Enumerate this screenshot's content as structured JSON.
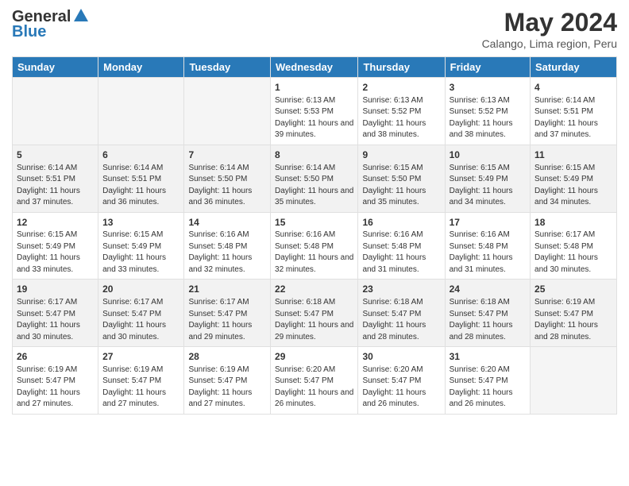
{
  "logo": {
    "line1": "General",
    "line2": "Blue"
  },
  "title": "May 2024",
  "subtitle": "Calango, Lima region, Peru",
  "weekdays": [
    "Sunday",
    "Monday",
    "Tuesday",
    "Wednesday",
    "Thursday",
    "Friday",
    "Saturday"
  ],
  "weeks": [
    [
      {
        "day": "",
        "sunrise": "",
        "sunset": "",
        "daylight": ""
      },
      {
        "day": "",
        "sunrise": "",
        "sunset": "",
        "daylight": ""
      },
      {
        "day": "",
        "sunrise": "",
        "sunset": "",
        "daylight": ""
      },
      {
        "day": "1",
        "sunrise": "Sunrise: 6:13 AM",
        "sunset": "Sunset: 5:53 PM",
        "daylight": "Daylight: 11 hours and 39 minutes."
      },
      {
        "day": "2",
        "sunrise": "Sunrise: 6:13 AM",
        "sunset": "Sunset: 5:52 PM",
        "daylight": "Daylight: 11 hours and 38 minutes."
      },
      {
        "day": "3",
        "sunrise": "Sunrise: 6:13 AM",
        "sunset": "Sunset: 5:52 PM",
        "daylight": "Daylight: 11 hours and 38 minutes."
      },
      {
        "day": "4",
        "sunrise": "Sunrise: 6:14 AM",
        "sunset": "Sunset: 5:51 PM",
        "daylight": "Daylight: 11 hours and 37 minutes."
      }
    ],
    [
      {
        "day": "5",
        "sunrise": "Sunrise: 6:14 AM",
        "sunset": "Sunset: 5:51 PM",
        "daylight": "Daylight: 11 hours and 37 minutes."
      },
      {
        "day": "6",
        "sunrise": "Sunrise: 6:14 AM",
        "sunset": "Sunset: 5:51 PM",
        "daylight": "Daylight: 11 hours and 36 minutes."
      },
      {
        "day": "7",
        "sunrise": "Sunrise: 6:14 AM",
        "sunset": "Sunset: 5:50 PM",
        "daylight": "Daylight: 11 hours and 36 minutes."
      },
      {
        "day": "8",
        "sunrise": "Sunrise: 6:14 AM",
        "sunset": "Sunset: 5:50 PM",
        "daylight": "Daylight: 11 hours and 35 minutes."
      },
      {
        "day": "9",
        "sunrise": "Sunrise: 6:15 AM",
        "sunset": "Sunset: 5:50 PM",
        "daylight": "Daylight: 11 hours and 35 minutes."
      },
      {
        "day": "10",
        "sunrise": "Sunrise: 6:15 AM",
        "sunset": "Sunset: 5:49 PM",
        "daylight": "Daylight: 11 hours and 34 minutes."
      },
      {
        "day": "11",
        "sunrise": "Sunrise: 6:15 AM",
        "sunset": "Sunset: 5:49 PM",
        "daylight": "Daylight: 11 hours and 34 minutes."
      }
    ],
    [
      {
        "day": "12",
        "sunrise": "Sunrise: 6:15 AM",
        "sunset": "Sunset: 5:49 PM",
        "daylight": "Daylight: 11 hours and 33 minutes."
      },
      {
        "day": "13",
        "sunrise": "Sunrise: 6:15 AM",
        "sunset": "Sunset: 5:49 PM",
        "daylight": "Daylight: 11 hours and 33 minutes."
      },
      {
        "day": "14",
        "sunrise": "Sunrise: 6:16 AM",
        "sunset": "Sunset: 5:48 PM",
        "daylight": "Daylight: 11 hours and 32 minutes."
      },
      {
        "day": "15",
        "sunrise": "Sunrise: 6:16 AM",
        "sunset": "Sunset: 5:48 PM",
        "daylight": "Daylight: 11 hours and 32 minutes."
      },
      {
        "day": "16",
        "sunrise": "Sunrise: 6:16 AM",
        "sunset": "Sunset: 5:48 PM",
        "daylight": "Daylight: 11 hours and 31 minutes."
      },
      {
        "day": "17",
        "sunrise": "Sunrise: 6:16 AM",
        "sunset": "Sunset: 5:48 PM",
        "daylight": "Daylight: 11 hours and 31 minutes."
      },
      {
        "day": "18",
        "sunrise": "Sunrise: 6:17 AM",
        "sunset": "Sunset: 5:48 PM",
        "daylight": "Daylight: 11 hours and 30 minutes."
      }
    ],
    [
      {
        "day": "19",
        "sunrise": "Sunrise: 6:17 AM",
        "sunset": "Sunset: 5:47 PM",
        "daylight": "Daylight: 11 hours and 30 minutes."
      },
      {
        "day": "20",
        "sunrise": "Sunrise: 6:17 AM",
        "sunset": "Sunset: 5:47 PM",
        "daylight": "Daylight: 11 hours and 30 minutes."
      },
      {
        "day": "21",
        "sunrise": "Sunrise: 6:17 AM",
        "sunset": "Sunset: 5:47 PM",
        "daylight": "Daylight: 11 hours and 29 minutes."
      },
      {
        "day": "22",
        "sunrise": "Sunrise: 6:18 AM",
        "sunset": "Sunset: 5:47 PM",
        "daylight": "Daylight: 11 hours and 29 minutes."
      },
      {
        "day": "23",
        "sunrise": "Sunrise: 6:18 AM",
        "sunset": "Sunset: 5:47 PM",
        "daylight": "Daylight: 11 hours and 28 minutes."
      },
      {
        "day": "24",
        "sunrise": "Sunrise: 6:18 AM",
        "sunset": "Sunset: 5:47 PM",
        "daylight": "Daylight: 11 hours and 28 minutes."
      },
      {
        "day": "25",
        "sunrise": "Sunrise: 6:19 AM",
        "sunset": "Sunset: 5:47 PM",
        "daylight": "Daylight: 11 hours and 28 minutes."
      }
    ],
    [
      {
        "day": "26",
        "sunrise": "Sunrise: 6:19 AM",
        "sunset": "Sunset: 5:47 PM",
        "daylight": "Daylight: 11 hours and 27 minutes."
      },
      {
        "day": "27",
        "sunrise": "Sunrise: 6:19 AM",
        "sunset": "Sunset: 5:47 PM",
        "daylight": "Daylight: 11 hours and 27 minutes."
      },
      {
        "day": "28",
        "sunrise": "Sunrise: 6:19 AM",
        "sunset": "Sunset: 5:47 PM",
        "daylight": "Daylight: 11 hours and 27 minutes."
      },
      {
        "day": "29",
        "sunrise": "Sunrise: 6:20 AM",
        "sunset": "Sunset: 5:47 PM",
        "daylight": "Daylight: 11 hours and 26 minutes."
      },
      {
        "day": "30",
        "sunrise": "Sunrise: 6:20 AM",
        "sunset": "Sunset: 5:47 PM",
        "daylight": "Daylight: 11 hours and 26 minutes."
      },
      {
        "day": "31",
        "sunrise": "Sunrise: 6:20 AM",
        "sunset": "Sunset: 5:47 PM",
        "daylight": "Daylight: 11 hours and 26 minutes."
      },
      {
        "day": "",
        "sunrise": "",
        "sunset": "",
        "daylight": ""
      }
    ]
  ]
}
